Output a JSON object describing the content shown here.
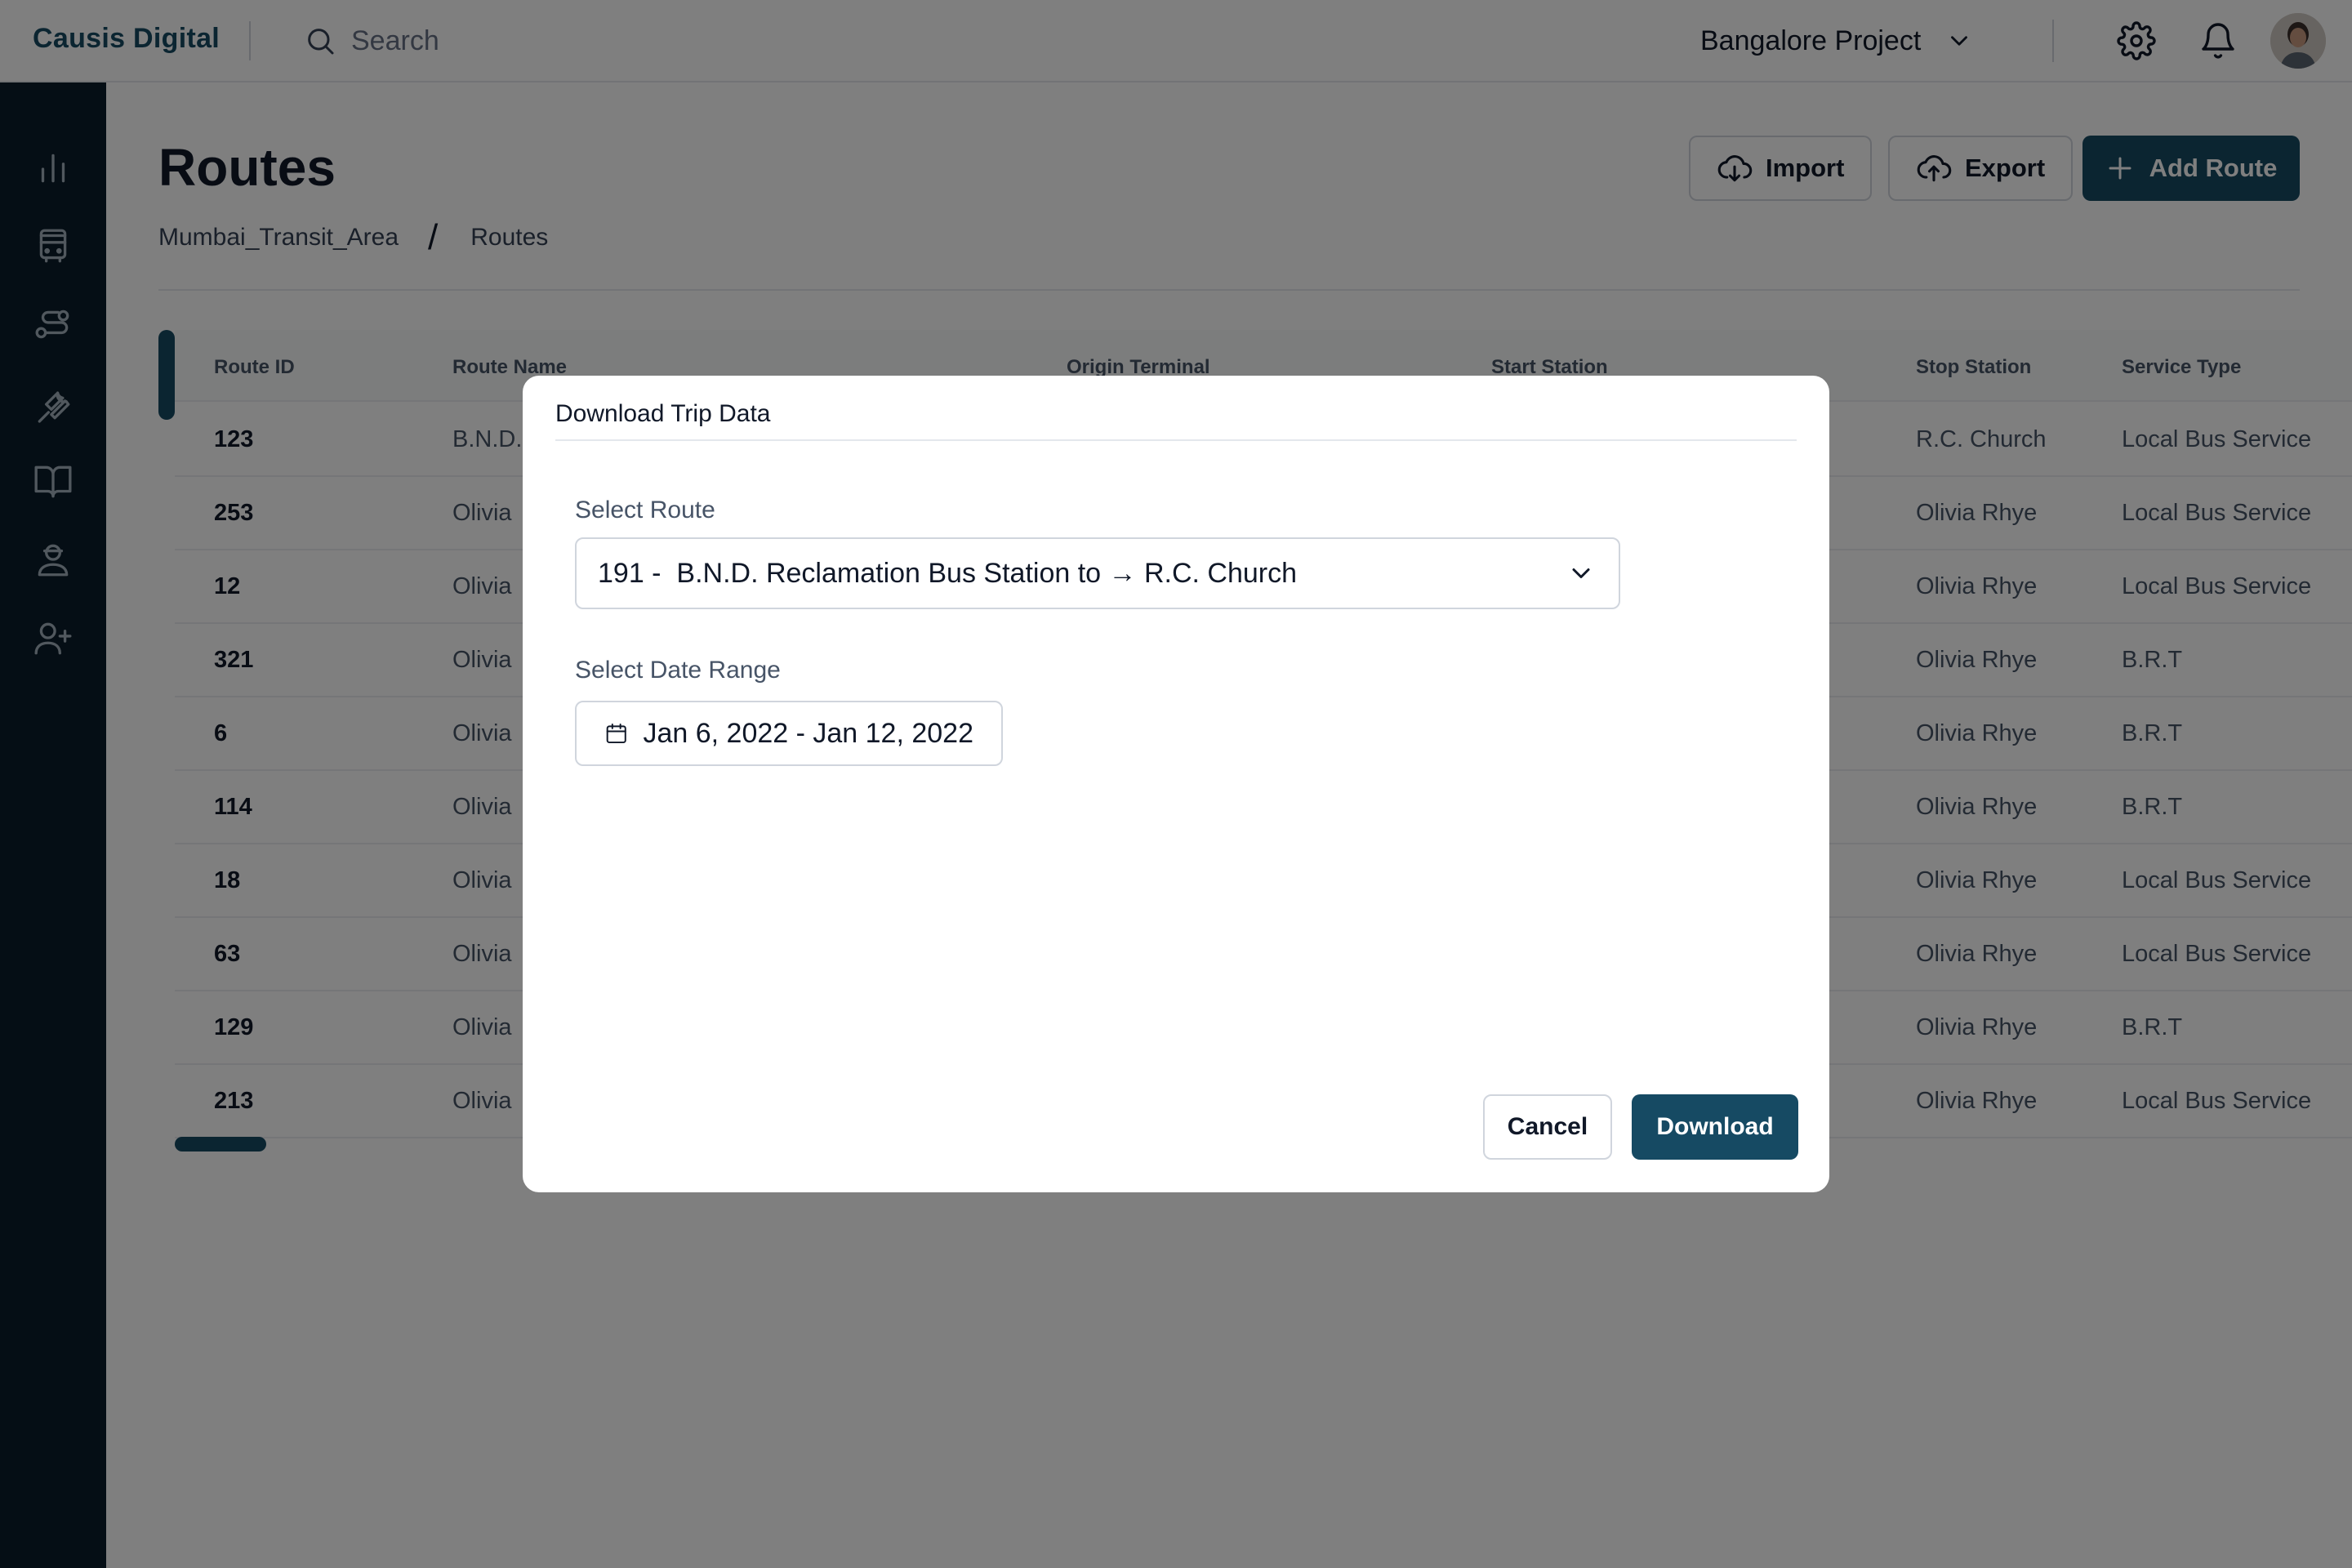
{
  "app": {
    "brand": "Causis Digital",
    "search_placeholder": "Search",
    "project": "Bangalore Project"
  },
  "page": {
    "title": "Routes",
    "breadcrumb": [
      "Mumbai_Transit_Area",
      "/",
      "Routes"
    ],
    "actions": {
      "import": "Import",
      "export": "Export",
      "add_route": "Add Route"
    }
  },
  "sidebar": {
    "items": [
      {
        "icon": "analytics-icon"
      },
      {
        "icon": "bus-icon"
      },
      {
        "icon": "routes-icon"
      },
      {
        "icon": "tools-icon"
      },
      {
        "icon": "book-icon"
      },
      {
        "icon": "operator-icon"
      },
      {
        "icon": "add-user-icon"
      }
    ]
  },
  "table": {
    "columns": [
      "Route ID",
      "Route Name",
      "Origin Terminal",
      "Start Station",
      "Stop Station",
      "Service Type"
    ],
    "rows": [
      {
        "id": "123",
        "name": "B.N.D.",
        "stop": "R.C. Church",
        "service": "Local Bus Service"
      },
      {
        "id": "253",
        "name": "Olivia",
        "stop": "Olivia Rhye",
        "service": "Local Bus Service"
      },
      {
        "id": "12",
        "name": "Olivia",
        "stop": "Olivia Rhye",
        "service": "Local Bus Service"
      },
      {
        "id": "321",
        "name": "Olivia",
        "stop": "Olivia Rhye",
        "service": "B.R.T"
      },
      {
        "id": "6",
        "name": "Olivia",
        "stop": "Olivia Rhye",
        "service": "B.R.T"
      },
      {
        "id": "114",
        "name": "Olivia",
        "stop": "Olivia Rhye",
        "service": "B.R.T"
      },
      {
        "id": "18",
        "name": "Olivia",
        "stop": "Olivia Rhye",
        "service": "Local Bus Service"
      },
      {
        "id": "63",
        "name": "Olivia",
        "stop": "Olivia Rhye",
        "service": "Local Bus Service"
      },
      {
        "id": "129",
        "name": "Olivia",
        "stop": "Olivia Rhye",
        "service": "B.R.T"
      },
      {
        "id": "213",
        "name": "Olivia",
        "stop": "Olivia Rhye",
        "service": "Local Bus Service"
      }
    ]
  },
  "modal": {
    "title": "Download Trip Data",
    "route_label": "Select Route",
    "route_value": "191 -  B.N.D. Reclamation Bus Station to → R.C. Church",
    "date_label": "Select Date Range",
    "date_value": "Jan 6, 2022 - Jan 12, 2022",
    "cancel": "Cancel",
    "download": "Download"
  },
  "colors": {
    "brand": "#164a63",
    "sidebar": "#0b1d2a",
    "overlay": "rgba(0,0,0,0.5)"
  }
}
